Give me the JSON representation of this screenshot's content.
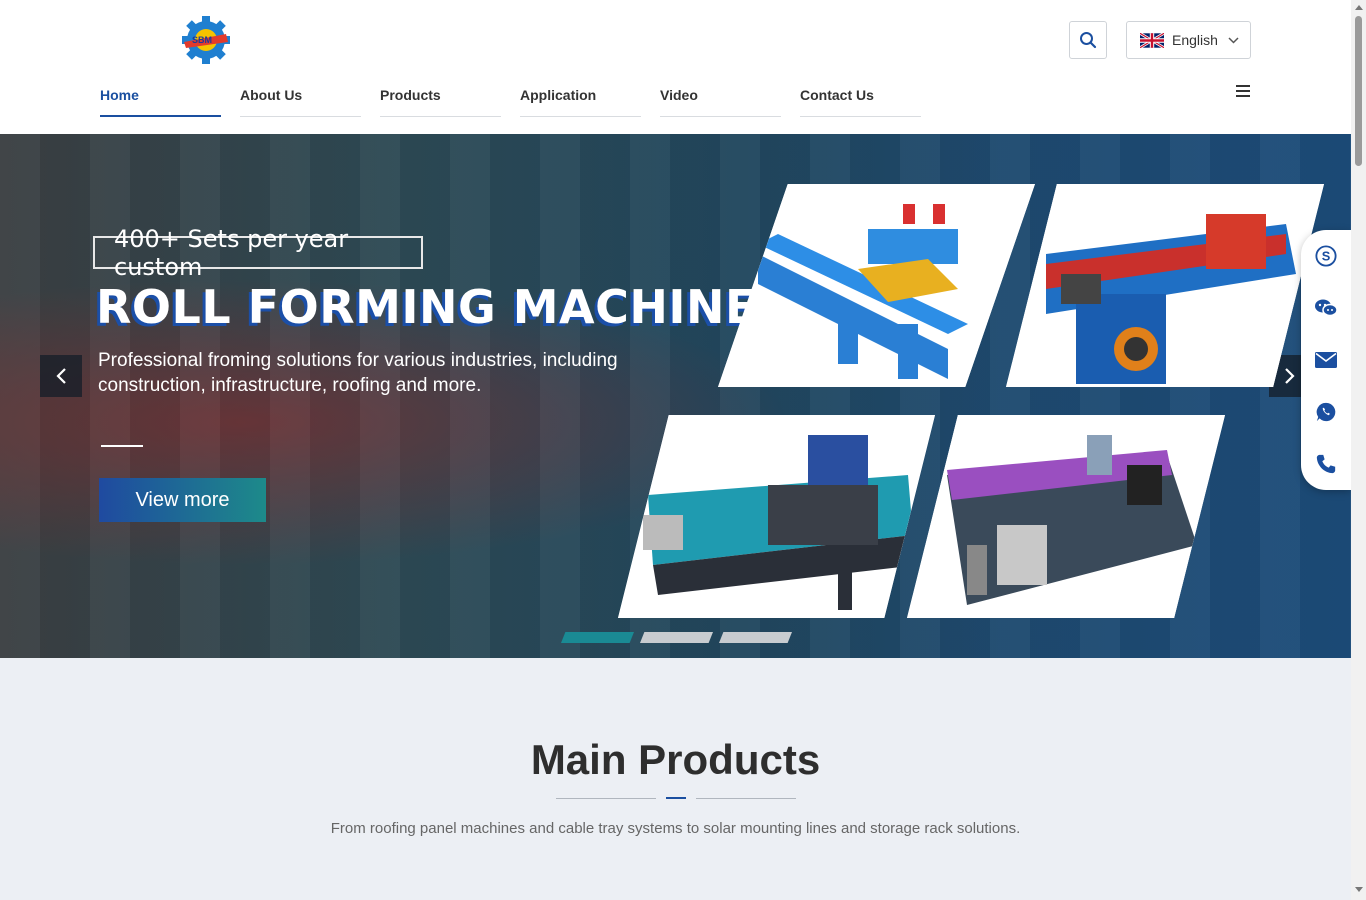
{
  "header": {
    "logo_text": "SBM",
    "language": {
      "selected": "English",
      "flag_icon": "uk-flag-icon"
    },
    "nav": [
      {
        "label": "Home",
        "active": true
      },
      {
        "label": "About Us",
        "active": false
      },
      {
        "label": "Products",
        "active": false
      },
      {
        "label": "Application",
        "active": false
      },
      {
        "label": "Video",
        "active": false
      },
      {
        "label": "Contact Us",
        "active": false
      }
    ]
  },
  "hero": {
    "tagline": "400+ Sets per year custom",
    "title": "ROLL FORMING MACHINE",
    "description": "Professional froming solutions for various industries, including construction, infrastructure, roofing and more.",
    "cta_label": "View more",
    "slides": 3,
    "active_slide": 1
  },
  "contact_bar": [
    "skype-icon",
    "wechat-icon",
    "email-icon",
    "whatsapp-icon",
    "phone-icon"
  ],
  "products_section": {
    "title": "Main Products",
    "subtitle": "From roofing panel machines and cable tray systems to solar mounting lines and storage rack solutions."
  },
  "colors": {
    "primary": "#1b4fa0",
    "accent_teal": "#1a8a94",
    "section_bg": "#eceff4"
  }
}
